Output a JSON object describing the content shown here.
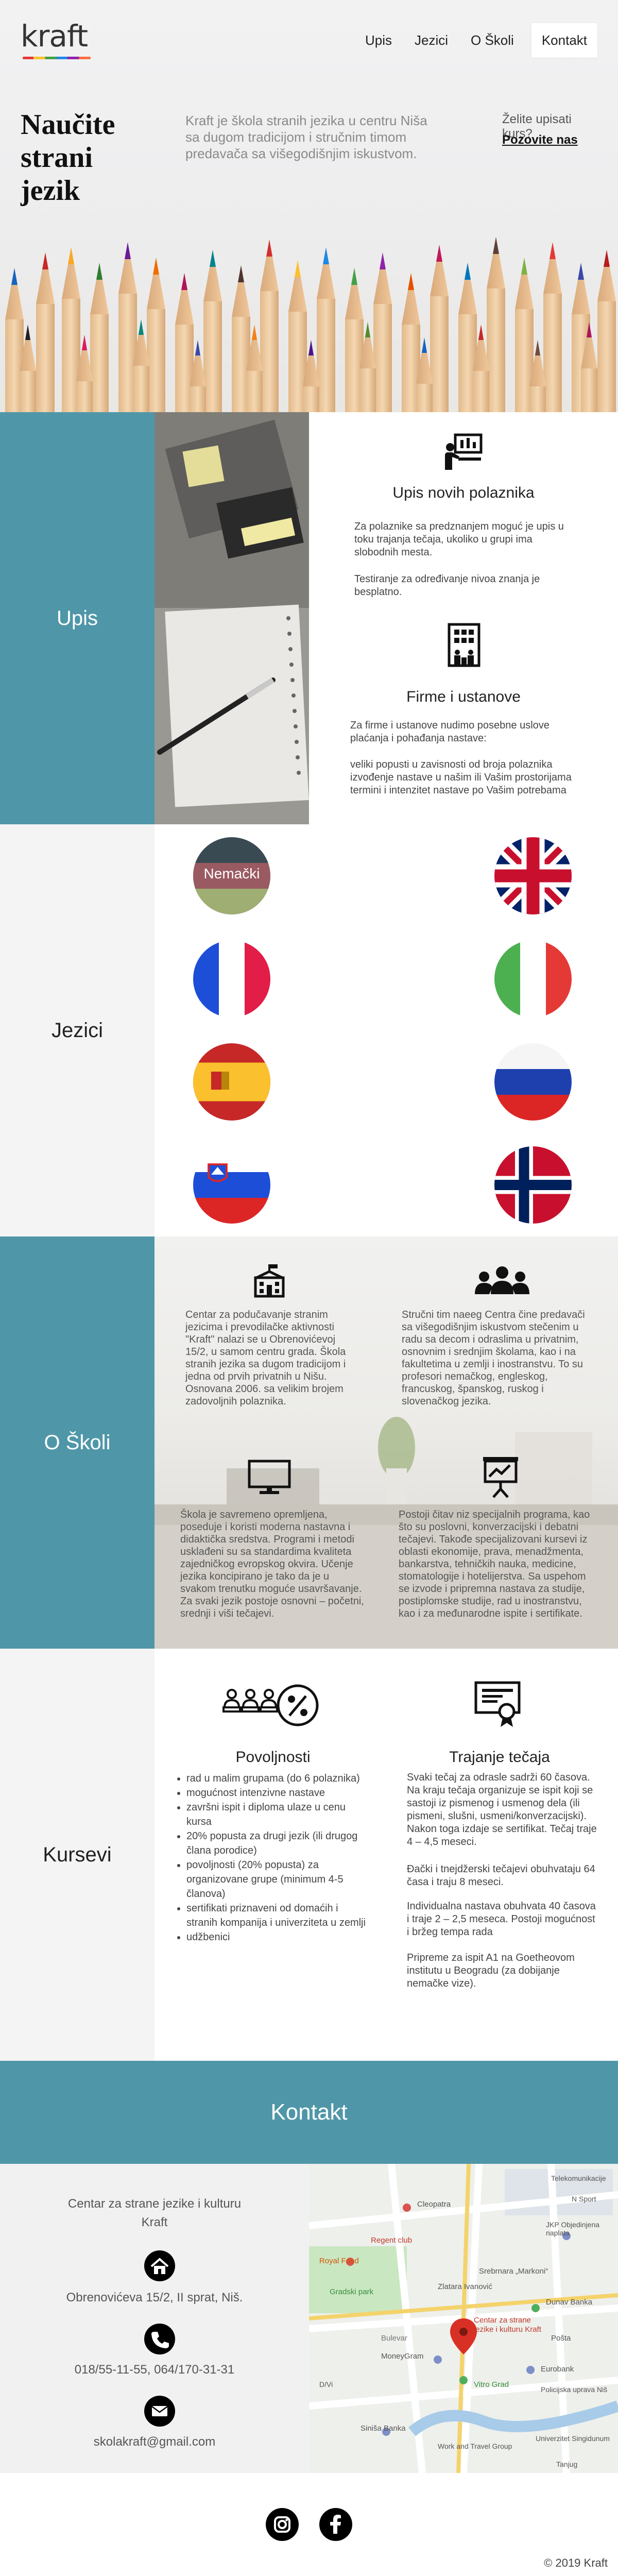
{
  "brand": {
    "name": "kraft"
  },
  "nav": [
    "Upis",
    "Jezici",
    "O Školi",
    "Kontakt"
  ],
  "hero": {
    "title": "Naučite strani jezik",
    "lead": "Kraft je škola stranih jezika u centru Niša sa dugom tradicijom i stručnim timom predavača sa višegodišnjim iskustvom.",
    "cta_question": "Želite upisati kurs?",
    "cta_link": "Pozovite nas"
  },
  "upis": {
    "label": "Upis",
    "block1": {
      "title": "Upis novih polaznika",
      "p1": "Za polaznike sa predznanjem moguć je upis u toku trajanja tečaja, ukoliko u grupi ima slobodnih mesta.",
      "p2": "Testiranje za određivanje nivoa znanja je besplatno."
    },
    "block2": {
      "title": "Firme i ustanove",
      "p1": "Za firme i ustanove nudimo posebne uslove plaćanja i pohađanja nastave:",
      "p2": "veliki popusti u zavisnosti od broja polaznika izvođenje nastave u našim ili Vašim prostorijama termini i intenzitet nastave po Vašim potrebama"
    }
  },
  "jezici": {
    "label": "Jezici",
    "flags": [
      "german-flag",
      "uk-flag",
      "france-flag",
      "italy-flag",
      "spain-flag",
      "russia-flag",
      "slovenia-flag",
      "norway-flag"
    ],
    "hover_caption": "Nemački"
  },
  "oskoli": {
    "label": "O Školi",
    "c1": "Centar za podučavanje stranim jezicima i prevodilačke aktivnosti \"Kraft\" nalazi se u Obrenovićevoj 15/2, u samom centru grada. Škola stranih jezika sa dugom tradicijom i jedna od prvih privatnih u Nišu. Osnovana 2006. sa velikim brojem zadovoljnih polaznika.",
    "c2": "Stručni tim naeeg Centra čine predavači sa višegodišnjim iskustvom stečenim u radu sa decom i odraslima u privatnim, osnovnim i srednjim školama, kao i na fakultetima u zemlji i inostranstvu. To su profesori nemačkog, engleskog, francuskog, španskog, ruskog i slovenačkog jezika.",
    "c3": "Škola je savremeno opremljena, poseduje i koristi moderna nastavna i didaktička sredstva. Programi i metodi usklađeni su sa standardima kvaliteta zajedničkog evropskog okvira. Učenje jezika koncipirano je tako da je u svakom trenutku moguće usavršavanje. Za svaki jezik postoje osnovni – početni, srednji i viši tečajevi.",
    "c4": "Postoji čitav niz specijalnih programa, kao što su poslovni, konverzacijski i debatni tečajevi. Takođe specijalizovani kursevi iz oblasti ekonomije, prava, menadžmenta, bankarstva, tehničkih nauka, medicine, stomatologije i hotelijerstva. Sa uspehom se izvode i pripremna nastava za studije, postiplomske studije, rad u inostranstvu, kao i za međunarodne ispite i sertifikate."
  },
  "kursevi": {
    "label": "Kursevi",
    "povoljnosti_title": "Povoljnosti",
    "povoljnosti": [
      "rad u malim grupama (do 6 polaznika)",
      "mogućnost intenzivne nastave",
      "završni ispit i diploma ulaze u cenu kursa",
      "20% popusta za drugi jezik (ili drugog člana porodice)",
      "povoljnosti (20% popusta) za organizovane grupe (minimum 4-5 članova)",
      "sertifikati priznaveni od domaćih i stranih kompanija i univerziteta u zemlji",
      "udžbenici"
    ],
    "trajanje_title": "Trajanje tečaja",
    "trajanje": [
      "Svaki tečaj za odrasle sadrži 60 časova. Na kraju tečaja organizuje se ispit koji se sastoji iz pismenog i usmenog dela (ili pismeni, slušni, usmeni/konverzacijski). Nakon toga izdaje se sertifikat. Tečaj traje 4 – 4,5 meseci.",
      "Đački i tnejdžerski tečajevi obuhvataju 64 časa i traju 8 meseci.",
      "Individualna nastava obuhvata 40 časova i traje 2 – 2,5 meseca. Postoji mogućnost i bržeg tempa rada",
      "Pripreme za ispit A1 na Goetheovom institutu u Beogradu (za dobijanje nemačke vize)."
    ]
  },
  "kontakt": {
    "title": "Kontakt",
    "org": "Centar za strane jezike i kulturu Kraft",
    "address": "Obrenovićeva 15/2, II sprat, Niš.",
    "phone": "018/55-11-55, 064/170-31-31",
    "email": "skolakraft@gmail.com",
    "map_labels": {
      "pin": "Centar za strane jezike i kulturu Kraft",
      "royal": "Royal Food",
      "gradski": "Gradski park",
      "regent": "Regent club",
      "dunav": "Dunav Banka",
      "cleopatra": "Cleopatra",
      "ivanovic": "Zlatara Ivanović",
      "markoni": "Srebrnara „Markoni“",
      "bulevar": "Bulevar",
      "moneygram": "MoneyGram",
      "vitro": "Vitro Grad",
      "jkp": "JKP Objedinjena naplata",
      "eurobank": "Eurobank",
      "posta": "Pošta",
      "sinisa": "Siniša Banka",
      "univerzitet": "Univerzitet Singidunum",
      "work": "Work and Travel Group",
      "tanjug": "Tanjug",
      "telecom": "Telekomunikacije",
      "policija": "Policijska uprava Niš",
      "nsport": "N Sport",
      "dvi": "D/Vi"
    }
  },
  "footer": {
    "copyright": "© 2019 Kraft"
  },
  "colors": {
    "teal": "#4f97a8",
    "grey": "#f4f4f4"
  }
}
